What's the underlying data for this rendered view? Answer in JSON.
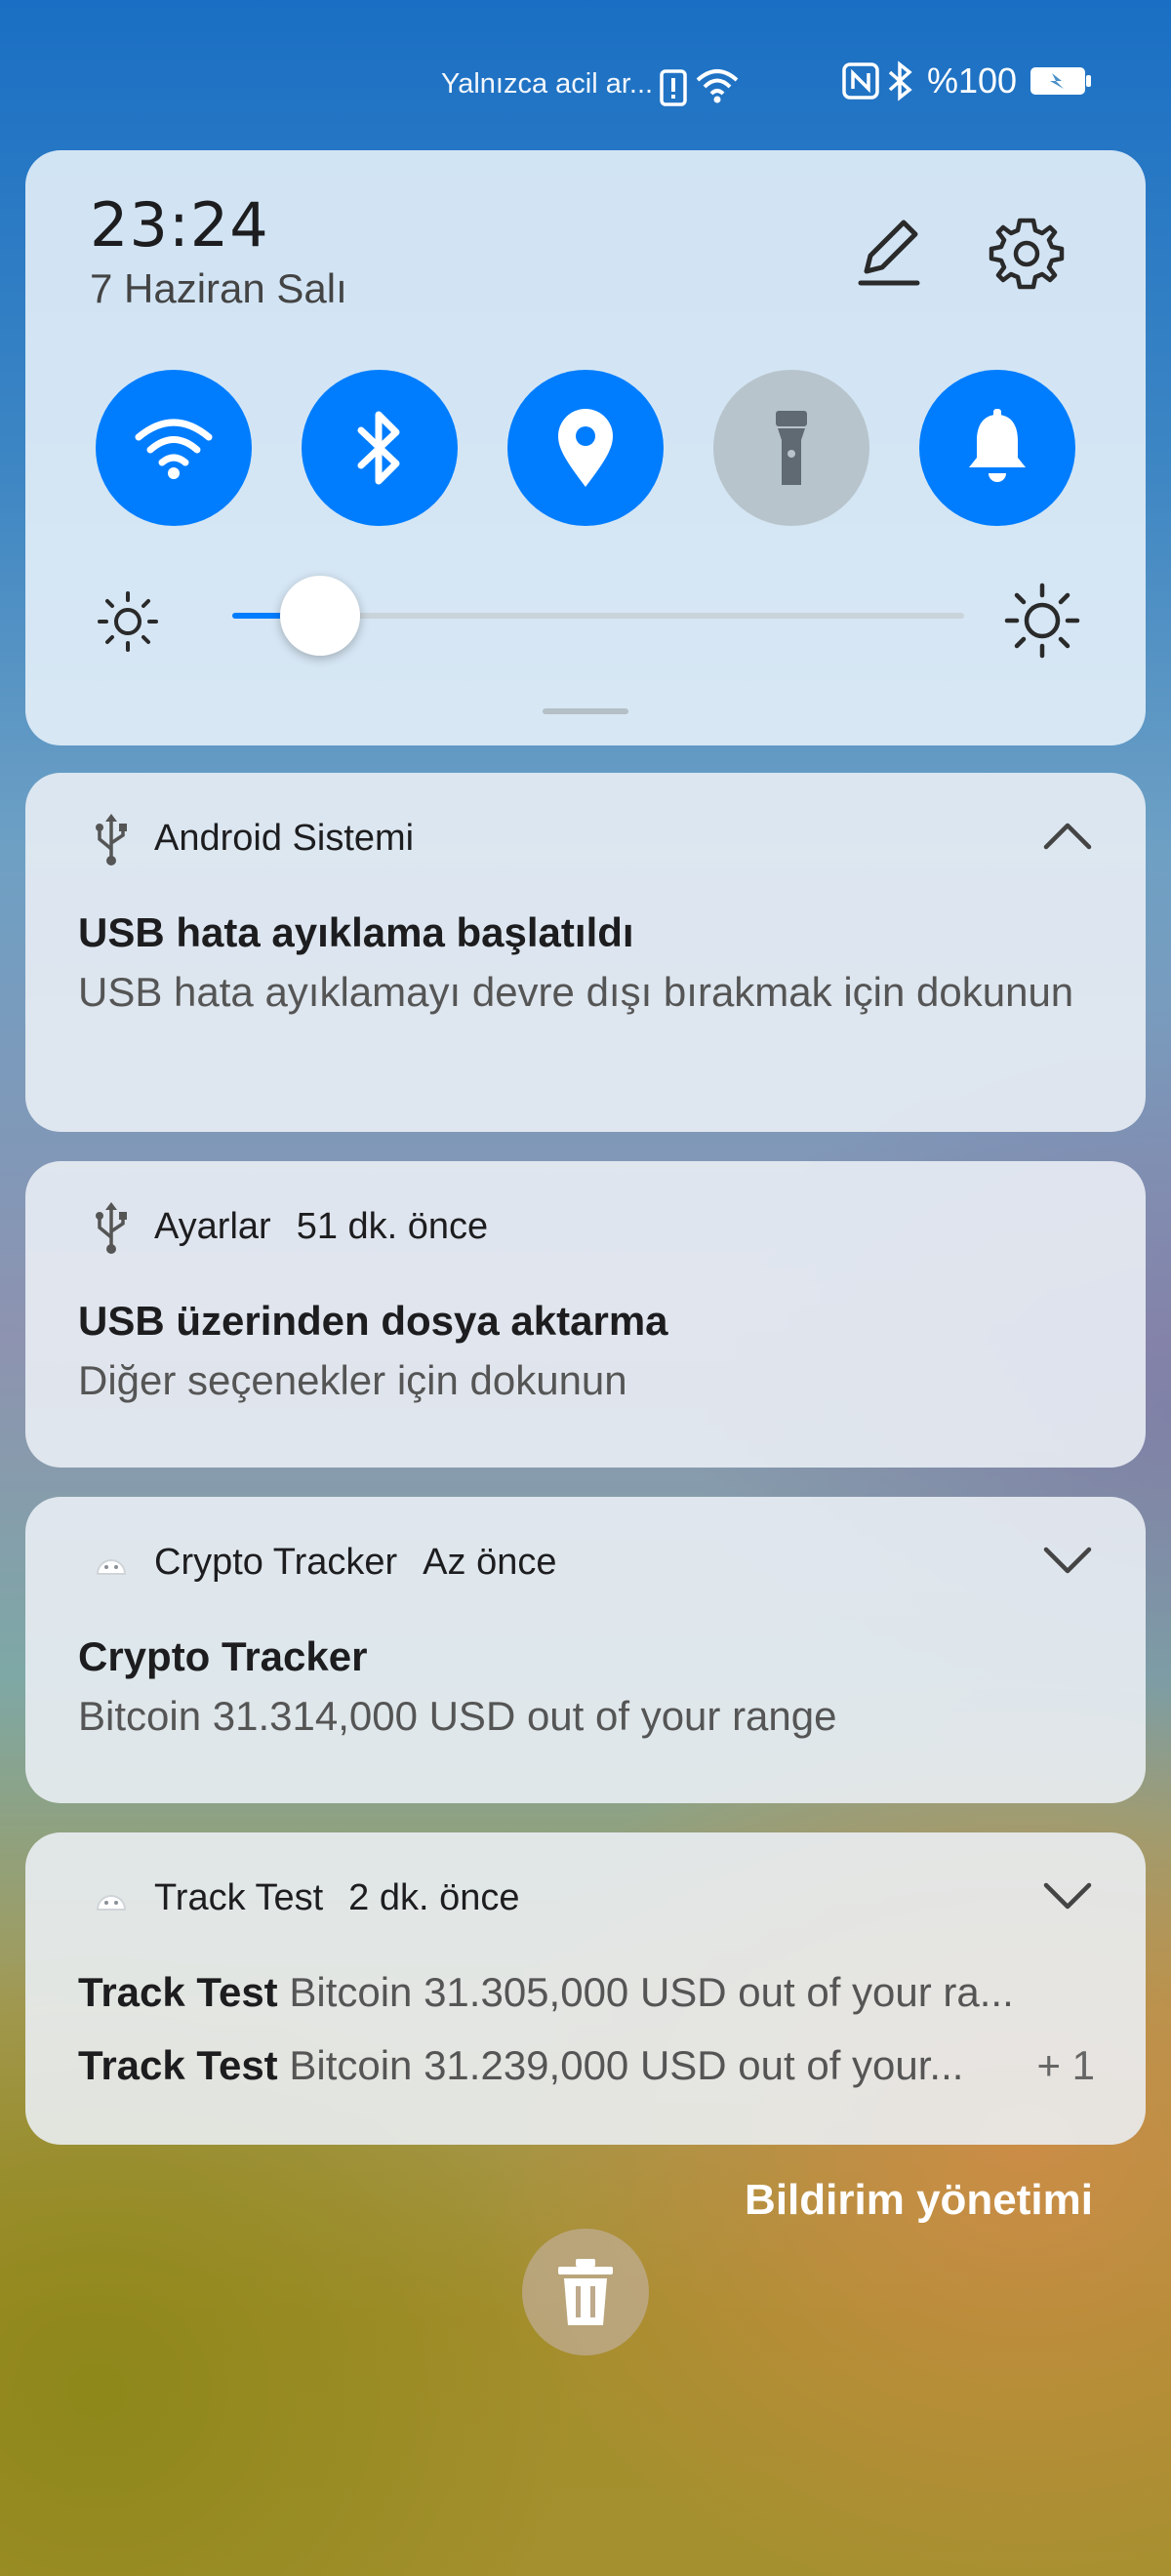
{
  "status_bar": {
    "carrier_text": "Yalnızca acil ar...",
    "battery_text": "%100",
    "icons": [
      "alert-icon",
      "wifi-icon",
      "nfc-icon",
      "bluetooth-icon",
      "battery-charging-icon"
    ]
  },
  "quick_settings": {
    "time": "23:24",
    "date": "7 Haziran Salı",
    "tiles": [
      {
        "name": "wifi",
        "icon": "wifi-icon",
        "on": true
      },
      {
        "name": "bluetooth",
        "icon": "bluetooth-icon",
        "on": true
      },
      {
        "name": "location",
        "icon": "location-icon",
        "on": true
      },
      {
        "name": "flashlight",
        "icon": "flashlight-icon",
        "on": false
      },
      {
        "name": "sound",
        "icon": "bell-icon",
        "on": true
      }
    ],
    "brightness_level": 0.12,
    "accent_color": "#007dff"
  },
  "notifications": [
    {
      "app": "Android Sistemi",
      "time": "",
      "icon": "usb-icon",
      "expanded": true,
      "title": "USB hata ayıklama başlatıldı",
      "body": "USB hata ayıklamayı devre dışı bırakmak için dokunun"
    },
    {
      "app": "Ayarlar",
      "time": "51 dk. önce",
      "icon": "usb-icon",
      "title": "USB üzerinden dosya aktarma",
      "body": "Diğer seçenekler için dokunun"
    },
    {
      "app": "Crypto Tracker",
      "time": "Az önce",
      "icon": "android-icon",
      "expanded": false,
      "title": "Crypto Tracker",
      "body": "Bitcoin 31.314,000 USD out of your range"
    },
    {
      "app": "Track Test",
      "time": "2 dk. önce",
      "icon": "android-icon",
      "expanded": false,
      "lines": [
        {
          "title": "Track Test",
          "text": "Bitcoin 31.305,000 USD out of your ra..."
        },
        {
          "title": "Track Test",
          "text": "Bitcoin 31.239,000 USD out of your..."
        }
      ],
      "more_count": "+ 1"
    }
  ],
  "manage_label": "Bildirim yönetimi"
}
